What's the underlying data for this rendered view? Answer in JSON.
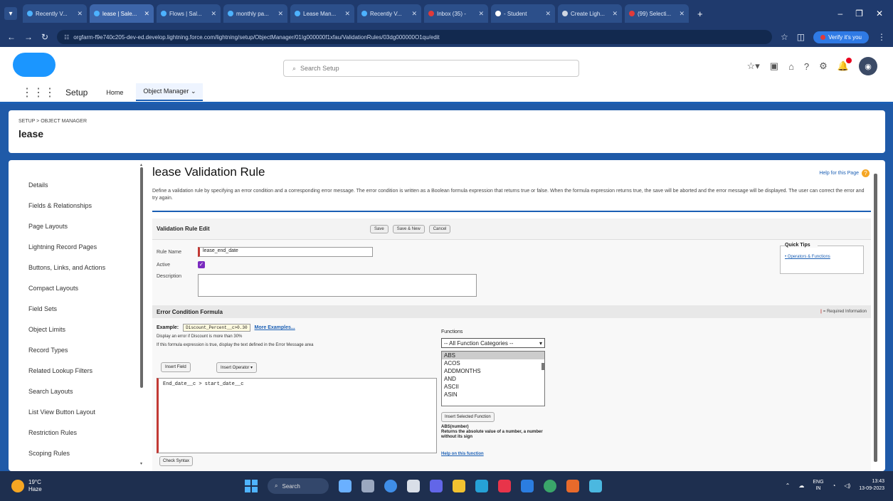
{
  "browser": {
    "tabs": [
      {
        "label": "Recently V...",
        "fav": "blue"
      },
      {
        "label": "lease | Sale...",
        "fav": "blue",
        "active": true
      },
      {
        "label": "Flows | Sal...",
        "fav": "blue"
      },
      {
        "label": "monthly pa...",
        "fav": "blue"
      },
      {
        "label": "Lease Man...",
        "fav": "blue"
      },
      {
        "label": "Recently V...",
        "fav": "blue"
      },
      {
        "label": "Inbox (35) -",
        "fav": "red"
      },
      {
        "label": "- Student",
        "fav": "white"
      },
      {
        "label": "Create Ligh...",
        "fav": "gray"
      },
      {
        "label": "(99) Selecti...",
        "fav": "red"
      }
    ],
    "url": "orgfarm-f9e740c205-dev-ed.develop.lightning.force.com/lightning/setup/ObjectManager/01Ig000000f1xfau/ValidationRules/03dg000000O1qu/edit",
    "verify_label": "Verify it's you"
  },
  "header": {
    "search_placeholder": "Search Setup"
  },
  "appnav": {
    "app_name": "Setup",
    "tabs": [
      "Home",
      "Object Manager"
    ]
  },
  "object": {
    "breadcrumb": "SETUP > OBJECT MANAGER",
    "title": "lease"
  },
  "sidebar": {
    "items": [
      "Details",
      "Fields & Relationships",
      "Page Layouts",
      "Lightning Record Pages",
      "Buttons, Links, and Actions",
      "Compact Layouts",
      "Field Sets",
      "Object Limits",
      "Record Types",
      "Related Lookup Filters",
      "Search Layouts",
      "List View Button Layout",
      "Restriction Rules",
      "Scoping Rules"
    ]
  },
  "main": {
    "title": "lease Validation Rule",
    "help_link": "Help for this Page",
    "description": "Define a validation rule by specifying an error condition and a corresponding error message. The error condition is written as a Boolean formula expression that returns true or false. When the formula expression returns true, the save will be aborted and the error message will be displayed. The user can correct the error and try again.",
    "edit_panel_title": "Validation Rule Edit",
    "buttons": {
      "save": "Save",
      "save_new": "Save & New",
      "cancel": "Cancel"
    },
    "rule_name_label": "Rule Name",
    "rule_name_value": "lease_end_date",
    "active_label": "Active",
    "description_label": "Description",
    "quick_tips_title": "Quick Tips",
    "quick_tips_link": "Operators & Functions",
    "section_title": "Error Condition Formula",
    "required_info": "= Required Information",
    "example_label": "Example:",
    "example_code": "Discount_Percent__c>0.30",
    "more_examples": "More Examples...",
    "example_desc": "Display an error if Discount is more than 30%",
    "formula_hint": "If this formula expression is true, display the text defined in the Error Message area",
    "insert_field": "Insert Field",
    "insert_operator": "Insert Operator",
    "formula_value": "End_date__c  >  start_date__c",
    "check_syntax": "Check Syntax",
    "functions_label": "Functions",
    "function_category": "-- All Function Categories --",
    "function_list": [
      "ABS",
      "ACOS",
      "ADDMONTHS",
      "AND",
      "ASCII",
      "ASIN"
    ],
    "insert_selected_function": "Insert Selected Function",
    "func_signature": "ABS(number)",
    "func_desc": "Returns the absolute value of a number, a number without its sign",
    "help_function": "Help on this function"
  },
  "taskbar": {
    "weather_temp": "19°C",
    "weather_desc": "Haze",
    "search_label": "Search",
    "lang": "ENG",
    "lang_sub": "IN",
    "time": "13:43",
    "date": "13-09-2023"
  }
}
